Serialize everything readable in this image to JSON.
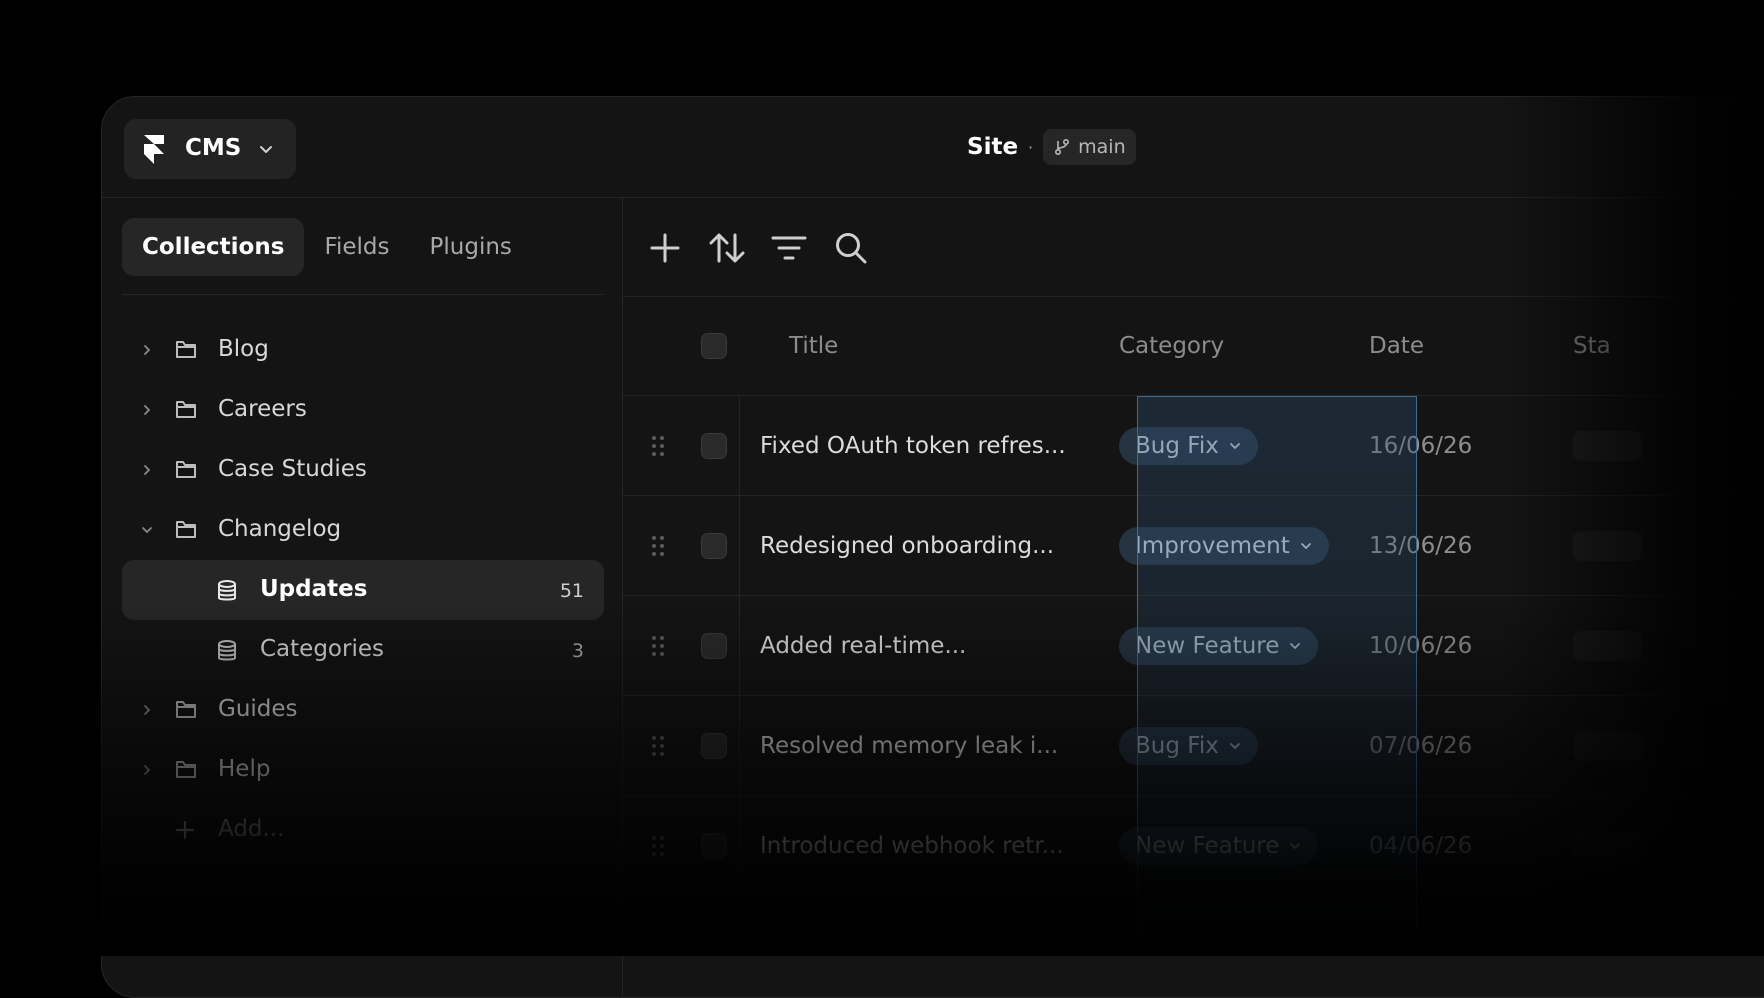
{
  "app": {
    "name": "CMS"
  },
  "header": {
    "site": "Site",
    "separator": "·",
    "branch": "main"
  },
  "sidebar": {
    "tabs": [
      {
        "label": "Collections",
        "active": true
      },
      {
        "label": "Fields",
        "active": false
      },
      {
        "label": "Plugins",
        "active": false
      }
    ],
    "tree": [
      {
        "label": "Blog",
        "expanded": false
      },
      {
        "label": "Careers",
        "expanded": false
      },
      {
        "label": "Case Studies",
        "expanded": false
      },
      {
        "label": "Changelog",
        "expanded": true
      },
      {
        "label": "Updates",
        "count": "51",
        "selected": true
      },
      {
        "label": "Categories",
        "count": "3"
      },
      {
        "label": "Guides",
        "expanded": false
      },
      {
        "label": "Help",
        "expanded": false
      }
    ],
    "add_label": "Add..."
  },
  "toolbar": {
    "icons": [
      "plus-icon",
      "sort-icon",
      "filter-icon",
      "search-icon"
    ]
  },
  "table": {
    "columns": [
      "Title",
      "Category",
      "Date",
      "Sta"
    ],
    "rows": [
      {
        "title": "Fixed OAuth token refres...",
        "category": "Bug Fix",
        "date": "16/06/26"
      },
      {
        "title": "Redesigned onboarding...",
        "category": "Improvement",
        "date": "13/06/26"
      },
      {
        "title": "Added real-time...",
        "category": "New Feature",
        "date": "10/06/26"
      },
      {
        "title": "Resolved memory leak i...",
        "category": "Bug Fix",
        "date": "07/06/26"
      },
      {
        "title": "Introduced webhook retr...",
        "category": "New Feature",
        "date": "04/06/26"
      }
    ]
  },
  "colors": {
    "background": "#000000",
    "panel": "#141414",
    "selected": "#262626",
    "highlight_border": "#3a6c96",
    "pill": "#263340"
  }
}
